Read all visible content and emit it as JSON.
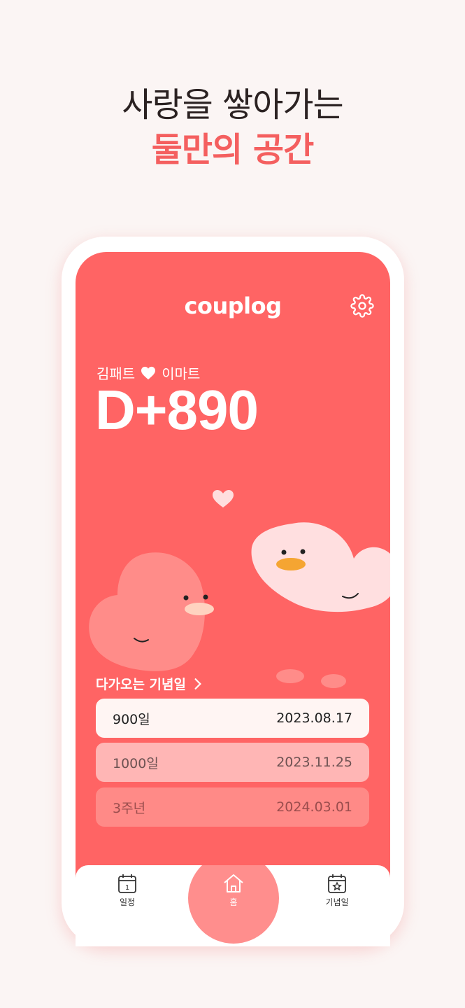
{
  "promo": {
    "line1": "사랑을 쌓아가는",
    "line2": "둘만의 공간"
  },
  "app": {
    "logo": "couplog",
    "settings_icon": "gear-icon",
    "couple": {
      "name1": "김패트",
      "heart_icon": "heart-icon",
      "name2": "이마트"
    },
    "dday": "D+890",
    "upcoming": {
      "title": "다가오는 기념일",
      "items": [
        {
          "label": "900일",
          "date": "2023.08.17"
        },
        {
          "label": "1000일",
          "date": "2023.11.25"
        },
        {
          "label": "3주년",
          "date": "2024.03.01"
        }
      ]
    },
    "tabs": [
      {
        "label": "일정",
        "icon": "calendar-icon"
      },
      {
        "label": "홈",
        "icon": "home-icon"
      },
      {
        "label": "기념일",
        "icon": "calendar-star-icon"
      }
    ]
  },
  "colors": {
    "accent": "#ff6464",
    "headline_accent": "#f45f5f",
    "background": "#fbf5f4"
  }
}
